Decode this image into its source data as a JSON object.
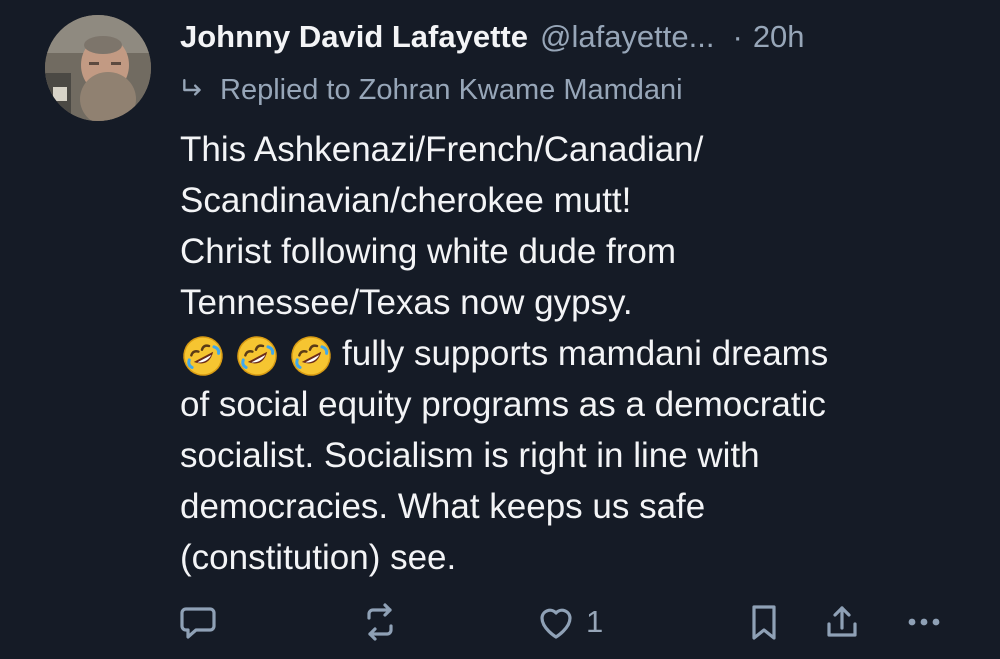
{
  "post": {
    "author_name": "Johnny David Lafayette",
    "handle": "@lafayette...",
    "separator": "·",
    "time_ago": "20h",
    "reply_text": "Replied to Zohran Kwame Mamdani",
    "body_lines": [
      "This Ashkenazi/French/Canadian/",
      "Scandinavian/cherokee mutt!",
      "Christ following white dude from",
      "Tennessee/Texas now gypsy.",
      "fully supports mamdani dreams",
      "of social equity programs as a democratic",
      "socialist.  Socialism is right in line with",
      "democracies. What keeps us safe",
      "(constitution) see."
    ],
    "emojis": [
      "rolling-on-the-floor-laughing-emoji",
      "rolling-on-the-floor-laughing-emoji",
      "rolling-on-the-floor-laughing-emoji"
    ],
    "actions": {
      "reply_icon": "reply-icon",
      "repost_icon": "repost-icon",
      "like_icon": "heart-icon",
      "like_count": "1",
      "bookmark_icon": "bookmark-icon",
      "share_icon": "share-icon",
      "more_icon": "more-icon"
    },
    "colors": {
      "background": "#151b26",
      "primary_text": "#f3f4f6",
      "secondary_text": "#97a6b8",
      "icon": "#8fa1b6"
    }
  }
}
